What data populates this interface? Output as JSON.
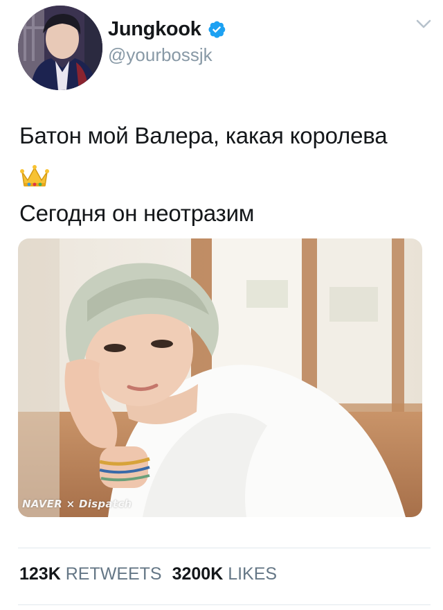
{
  "user": {
    "display_name": "Jungkook",
    "handle": "@yourbossjk",
    "verified": true,
    "avatar_icon": "profile-avatar"
  },
  "menu_icon": "chevron-down-icon",
  "tweet": {
    "line1": "Батон мой Валера, какая королева",
    "emoji": "crown-emoji",
    "line3": "Сегодня он неотразим"
  },
  "media": {
    "watermark": "NAVER × Dispatch"
  },
  "stats": {
    "retweets_count": "123K",
    "retweets_label": "RETWEETS",
    "likes_count": "3200K",
    "likes_label": "LIKES"
  },
  "colors": {
    "verified": "#1da1f2",
    "handle": "#8899a6",
    "divider": "#e1e8ed"
  }
}
